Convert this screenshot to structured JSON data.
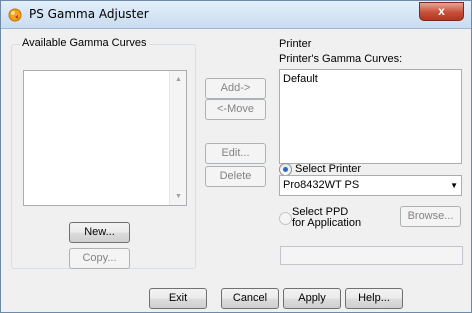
{
  "window": {
    "title": "PS Gamma Adjuster",
    "close_label": "x"
  },
  "available": {
    "legend": "Available Gamma Curves",
    "items": [],
    "new_label": "New...",
    "copy_label": "Copy..."
  },
  "middle": {
    "add_label": "Add->",
    "move_label": "<-Move",
    "edit_label": "Edit...",
    "delete_label": "Delete"
  },
  "printer": {
    "legend": "Printer",
    "curves_label": "Printer's Gamma Curves:",
    "curves": [
      "Default"
    ],
    "select_printer_label": "Select Printer",
    "printer_value": "Pro8432WT PS",
    "select_ppd_line1": "Select PPD",
    "select_ppd_line2": "for Application",
    "browse_label": "Browse...",
    "ppd_path": ""
  },
  "footer": {
    "exit_label": "Exit",
    "cancel_label": "Cancel",
    "apply_label": "Apply",
    "help_label": "Help..."
  },
  "colors": {
    "radio_selected": "#2a6bc4",
    "close_button": "#c7503a"
  }
}
